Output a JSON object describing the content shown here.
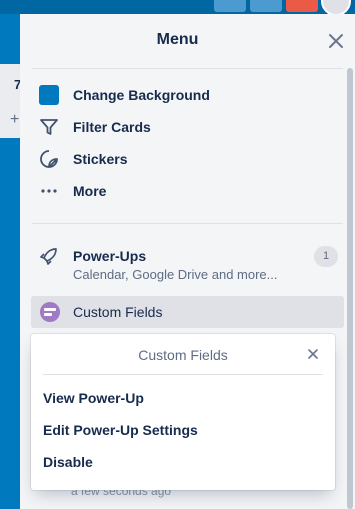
{
  "menu": {
    "title": "Menu",
    "items": [
      {
        "label": "Change Background",
        "icon": "color-swatch-icon"
      },
      {
        "label": "Filter Cards",
        "icon": "filter-icon"
      },
      {
        "label": "Stickers",
        "icon": "sticker-icon"
      },
      {
        "label": "More",
        "icon": "more-dots-icon"
      }
    ],
    "powerups": {
      "label": "Power-Ups",
      "subtitle": "Calendar, Google Drive and more...",
      "count": "1"
    },
    "custom_fields": {
      "label": "Custom Fields"
    },
    "activity_time": "a few seconds ago"
  },
  "board": {
    "column_char": "7",
    "add_char": "+"
  },
  "popover": {
    "title": "Custom Fields",
    "items": [
      "View Power-Up",
      "Edit Power-Up Settings",
      "Disable"
    ]
  },
  "colors": {
    "board_bg": "#0079bf",
    "accent_purple": "#a07ac4",
    "notification_red": "#eb5a46"
  }
}
